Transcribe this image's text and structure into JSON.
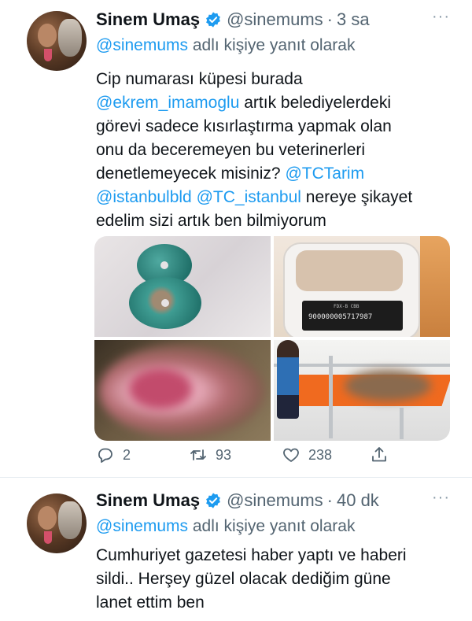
{
  "tweets": [
    {
      "author_name": "Sinem Umaş",
      "handle": "@sinemums",
      "separator": "·",
      "time": "3 sa",
      "more": "···",
      "reply_to_mention": "@sinemums",
      "reply_to_suffix": " adlı kişiye yanıt olarak",
      "body": {
        "l1": "Cip numarası küpesi burada",
        "l2_mention": "@ekrem_imamoglu",
        "l2_text": " artık belediyelerdeki",
        "l3": "görevi sadece kısırlaştırma yapmak olan",
        "l4": "onu da beceremeyen bu veterinerleri",
        "l5_text": "denetlemeyecek misiniz? ",
        "l5_mention": "@TCTarim",
        "l6_mention1": "@istanbulbld",
        "l6_space": " ",
        "l6_mention2": "@TC_istanbul",
        "l6_text": "  nereye şikayet",
        "l7": "edelim sizi artık ben bilmiyorum"
      },
      "media": {
        "scanner_header": "FDX-B     CBB",
        "scanner_reading": "900000005717987"
      },
      "actions": {
        "replies": "2",
        "retweets": "93",
        "likes": "238"
      }
    },
    {
      "author_name": "Sinem Umaş",
      "handle": "@sinemums",
      "separator": "·",
      "time": "40 dk",
      "more": "···",
      "reply_to_mention": "@sinemums",
      "reply_to_suffix": " adlı kişiye yanıt olarak",
      "body": {
        "l1": "Cumhuriyet gazetesi haber yaptı ve haberi",
        "l2": "sildi.. Herşey güzel olacak dediğim güne",
        "l3": "lanet ettim ben"
      }
    }
  ],
  "icons": {
    "verified": "verified-badge-icon",
    "reply": "reply-icon",
    "retweet": "retweet-icon",
    "like": "heart-icon",
    "share": "share-icon"
  },
  "colors": {
    "accent": "#1d9bf0",
    "muted": "#536471",
    "text": "#0f1419"
  }
}
